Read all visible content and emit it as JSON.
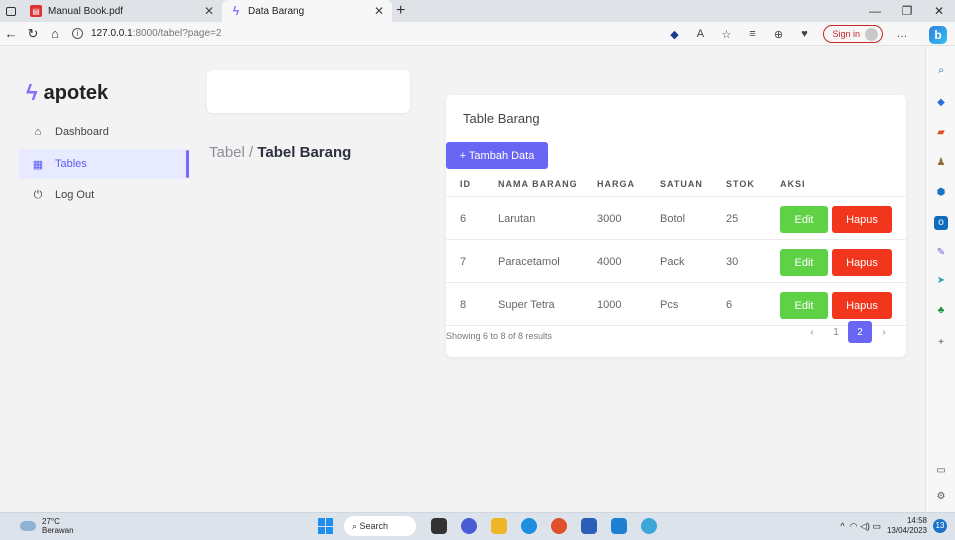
{
  "browser": {
    "tabs": [
      {
        "title": "Manual Book.pdf"
      },
      {
        "title": "Data Barang"
      }
    ],
    "url_host": "127.0.0.1",
    "url_path": ":8000/tabel?page=2",
    "signin_label": "Sign in"
  },
  "sidebar": {
    "brand": "apotek",
    "items": [
      {
        "label": "Dashboard",
        "icon": "home-icon"
      },
      {
        "label": "Tables",
        "icon": "table-icon"
      },
      {
        "label": "Log Out",
        "icon": "power-icon"
      }
    ],
    "accent": "#6866f2"
  },
  "breadcrumb": {
    "parent": "Tabel /",
    "current": "Tabel Barang"
  },
  "card": {
    "title": "Table Barang",
    "add_label": "+ Tambah Data",
    "columns": [
      "ID",
      "NAMA BARANG",
      "HARGA",
      "SATUAN",
      "STOK",
      "AKSI"
    ],
    "rows": [
      {
        "id": "6",
        "nama": "Larutan",
        "harga": "3000",
        "satuan": "Botol",
        "stok": "25"
      },
      {
        "id": "7",
        "nama": "Paracetamol",
        "harga": "4000",
        "satuan": "Pack",
        "stok": "30"
      },
      {
        "id": "8",
        "nama": "Super Tetra",
        "harga": "1000",
        "satuan": "Pcs",
        "stok": "6"
      }
    ],
    "edit_label": "Edit",
    "delete_label": "Hapus",
    "showing": "Showing 6 to 8 of 8 results",
    "pages": {
      "prev": "‹",
      "p1": "1",
      "p2": "2",
      "next": "›"
    }
  },
  "taskbar": {
    "temp": "27°C",
    "weather": "Berawan",
    "search_label": "Search",
    "time": "14:58",
    "date": "13/04/2023",
    "notif_count": "13"
  }
}
